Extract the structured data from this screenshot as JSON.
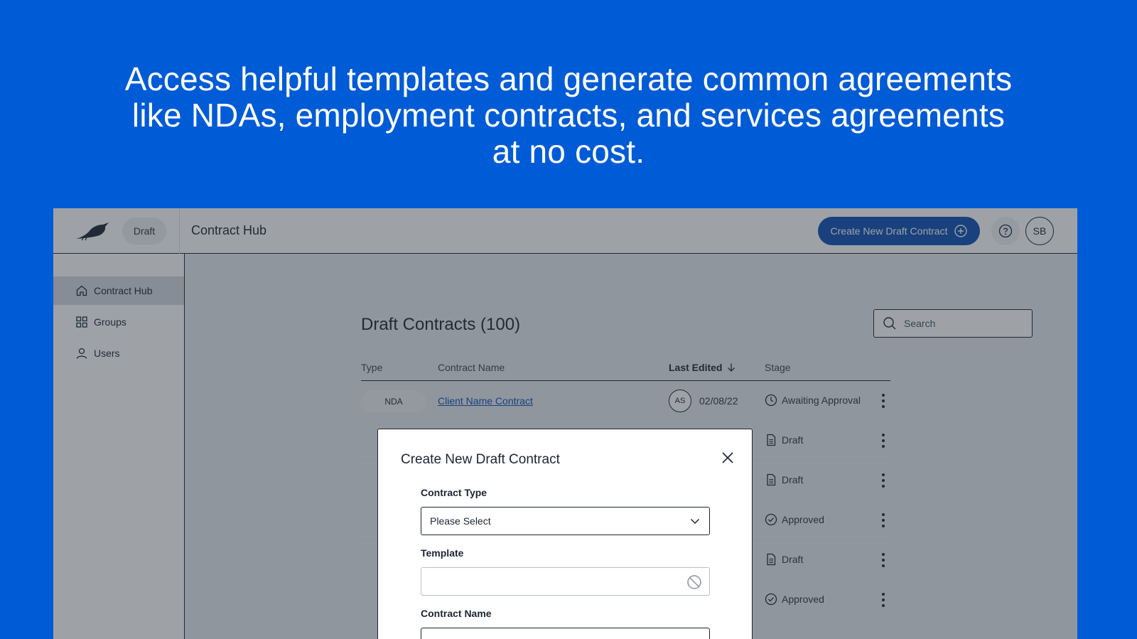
{
  "headline": {
    "line1": "Access helpful templates and generate common agreements",
    "line2": "like NDAs, employment contracts, and services agreements",
    "line3": "at no cost."
  },
  "topbar": {
    "logo_icon": "bird-logo-icon",
    "draft_label": "Draft",
    "title": "Contract Hub",
    "create_button_label": "Create New Draft Contract",
    "help_icon": "question-circle-icon",
    "avatar_initials": "SB"
  },
  "sidebar": {
    "items": [
      {
        "label": "Contract Hub",
        "icon": "home-icon",
        "active": true
      },
      {
        "label": "Groups",
        "icon": "grid-icon",
        "active": false
      },
      {
        "label": "Users",
        "icon": "user-icon",
        "active": false
      }
    ]
  },
  "main": {
    "title": "Draft Contracts (100)",
    "search_placeholder": "Search",
    "columns": {
      "type": "Type",
      "name": "Contract Name",
      "last_edited": "Last Edited",
      "stage": "Stage"
    },
    "rows": [
      {
        "type": "NDA",
        "name": "Client Name Contract",
        "editor": "AS",
        "date": "02/08/22",
        "stage": "Awaiting Approval",
        "stage_icon": "clock-icon"
      },
      {
        "stage": "Draft",
        "stage_icon": "document-icon"
      },
      {
        "stage": "Draft",
        "stage_icon": "document-icon"
      },
      {
        "stage": "Approved",
        "stage_icon": "check-circle-icon"
      },
      {
        "stage": "Draft",
        "stage_icon": "document-icon"
      },
      {
        "stage": "Approved",
        "stage_icon": "check-circle-icon"
      }
    ]
  },
  "modal": {
    "title": "Create New Draft Contract",
    "contract_type_label": "Contract Type",
    "contract_type_value": "Please Select",
    "template_label": "Template",
    "contract_name_label": "Contract Name"
  },
  "colors": {
    "background": "#005bd6",
    "primary_button": "#0c4fb3",
    "text": "#1d2532"
  }
}
